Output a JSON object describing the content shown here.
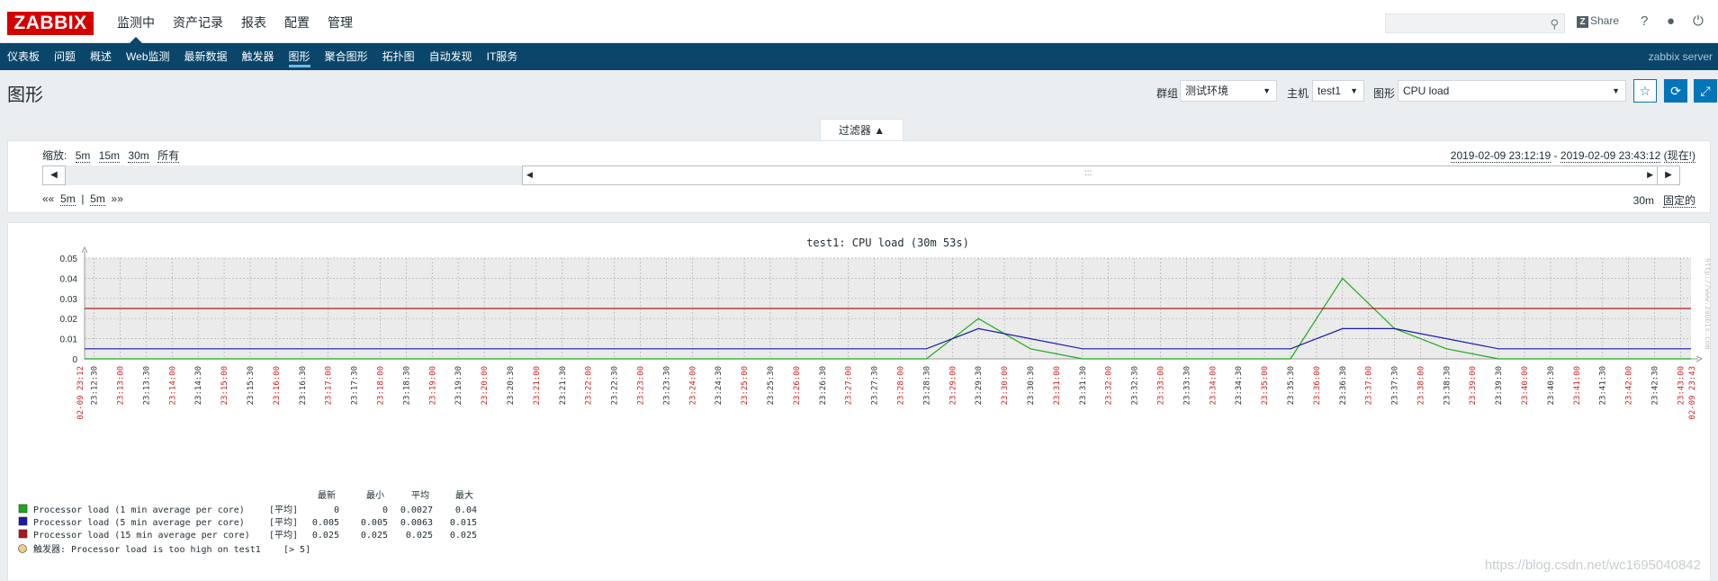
{
  "header": {
    "logo": "ZABBIX",
    "menu": [
      {
        "label": "监测中",
        "active": true
      },
      {
        "label": "资产记录",
        "active": false
      },
      {
        "label": "报表",
        "active": false
      },
      {
        "label": "配置",
        "active": false
      },
      {
        "label": "管理",
        "active": false
      }
    ],
    "search_placeholder": "",
    "share_label": "Share",
    "help_icon": "question-icon",
    "user_icon": "user-icon",
    "logout_icon": "power-icon"
  },
  "subnav": {
    "items": [
      {
        "label": "仪表板",
        "active": false
      },
      {
        "label": "问题",
        "active": false
      },
      {
        "label": "概述",
        "active": false
      },
      {
        "label": "Web监测",
        "active": false
      },
      {
        "label": "最新数据",
        "active": false
      },
      {
        "label": "触发器",
        "active": false
      },
      {
        "label": "图形",
        "active": true
      },
      {
        "label": "聚合图形",
        "active": false
      },
      {
        "label": "拓扑图",
        "active": false
      },
      {
        "label": "自动发现",
        "active": false
      },
      {
        "label": "IT服务",
        "active": false
      }
    ],
    "server": "zabbix server"
  },
  "page": {
    "title": "图形",
    "group_label": "群组",
    "group_value": "测试环境",
    "host_label": "主机",
    "host_value": "test1",
    "graph_label": "图形",
    "graph_value": "CPU load"
  },
  "filter": {
    "tab_label": "过滤器 ▲",
    "zoom_label": "缩放:",
    "zoom_options": [
      "5m",
      "15m",
      "30m",
      "所有"
    ],
    "range_from": "2019-02-09 23:12:19",
    "range_sep": " - ",
    "range_to": "2019-02-09 23:43:12",
    "range_now": "(现在!)",
    "step_back": "««",
    "step_1": "5m",
    "step_sep": "|",
    "step_2": "5m",
    "step_fwd": "»»",
    "period": "30m",
    "fixed": "固定的"
  },
  "chart_data": {
    "type": "line",
    "title": "test1: CPU load (30m 53s)",
    "ylim": [
      0,
      0.05
    ],
    "yticks": [
      "0.05",
      "0.04",
      "0.03",
      "0.02",
      "0.01",
      "0"
    ],
    "start_label": "02-09 23:12",
    "end_label": "02-09 23:43",
    "x_ticks": [
      "23:12:30",
      "23:13:00",
      "23:13:30",
      "23:14:00",
      "23:14:30",
      "23:15:00",
      "23:15:30",
      "23:16:00",
      "23:16:30",
      "23:17:00",
      "23:17:30",
      "23:18:00",
      "23:18:30",
      "23:19:00",
      "23:19:30",
      "23:20:00",
      "23:20:30",
      "23:21:00",
      "23:21:30",
      "23:22:00",
      "23:22:30",
      "23:23:00",
      "23:23:30",
      "23:24:00",
      "23:24:30",
      "23:25:00",
      "23:25:30",
      "23:26:00",
      "23:26:30",
      "23:27:00",
      "23:27:30",
      "23:28:00",
      "23:28:30",
      "23:29:00",
      "23:29:30",
      "23:30:00",
      "23:30:30",
      "23:31:00",
      "23:31:30",
      "23:32:00",
      "23:32:30",
      "23:33:00",
      "23:33:30",
      "23:34:00",
      "23:34:30",
      "23:35:00",
      "23:35:30",
      "23:36:00",
      "23:36:30",
      "23:37:00",
      "23:37:30",
      "23:38:00",
      "23:38:30",
      "23:39:00",
      "23:39:30",
      "23:40:00",
      "23:40:30",
      "23:41:00",
      "23:41:30",
      "23:42:00",
      "23:42:30",
      "23:43:00"
    ],
    "series": [
      {
        "name": "Processor load (1 min average per core)",
        "color": "#1aaa1a",
        "x": [
          "23:12:19",
          "23:28:30",
          "23:29:30",
          "23:30:30",
          "23:31:30",
          "23:35:30",
          "23:36:30",
          "23:37:30",
          "23:38:30",
          "23:39:30",
          "23:43:12"
        ],
        "y": [
          0,
          0,
          0.02,
          0.005,
          0,
          0,
          0.04,
          0.015,
          0.005,
          0,
          0
        ]
      },
      {
        "name": "Processor load (5 min average per core)",
        "color": "#1a1aa8",
        "x": [
          "23:12:19",
          "23:28:30",
          "23:29:30",
          "23:31:30",
          "23:35:30",
          "23:36:30",
          "23:37:30",
          "23:39:30",
          "23:43:12"
        ],
        "y": [
          0.005,
          0.005,
          0.015,
          0.005,
          0.005,
          0.015,
          0.015,
          0.005,
          0.005
        ]
      },
      {
        "name": "Processor load (15 min average per core)",
        "color": "#aa1a1a",
        "x": [
          "23:12:19",
          "23:43:12"
        ],
        "y": [
          0.025,
          0.025
        ]
      }
    ],
    "legend_headers": [
      "最新",
      "最小",
      "平均",
      "最大"
    ],
    "legend_rows": [
      {
        "name": "Processor load (1 min average per core)",
        "func": "[平均]",
        "last": "0",
        "min": "0",
        "avg": "0.0027",
        "max": "0.04",
        "color": "#1aaa1a"
      },
      {
        "name": "Processor load (5 min average per core)",
        "func": "[平均]",
        "last": "0.005",
        "min": "0.005",
        "avg": "0.0063",
        "max": "0.015",
        "color": "#1a1aa8"
      },
      {
        "name": "Processor load (15 min average per core)",
        "func": "[平均]",
        "last": "0.025",
        "min": "0.025",
        "avg": "0.025",
        "max": "0.025",
        "color": "#aa1a1a"
      }
    ],
    "trigger": {
      "label": "触发器: Processor load is too high on test1",
      "cond": "[> 5]",
      "color": "#f3c98a"
    },
    "side_text": "http://www.zabbix.com"
  },
  "watermark": "https://blog.csdn.net/wc1695040842"
}
